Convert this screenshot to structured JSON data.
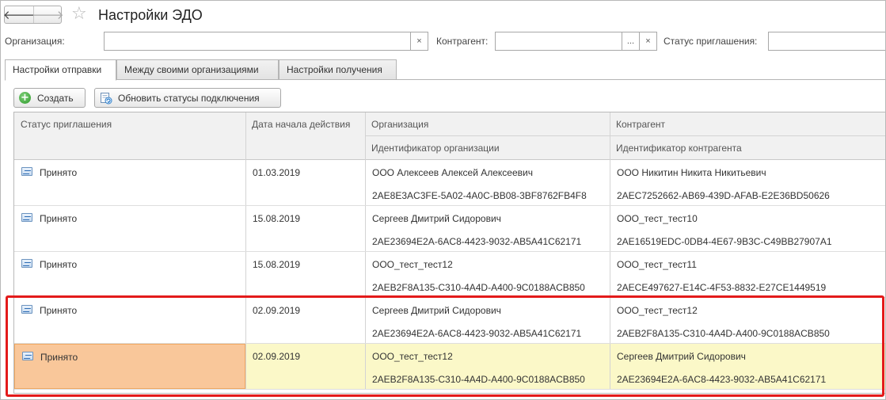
{
  "window": {
    "title": "Настройки ЭДО"
  },
  "filters": {
    "organization_label": "Организация:",
    "organization_value": "",
    "counterparty_label": "Контрагент:",
    "counterparty_value": "",
    "status_label": "Статус приглашения:",
    "status_value": "",
    "clear_glyph": "×",
    "choose_glyph": "..."
  },
  "tabs": [
    {
      "label": "Настройки отправки",
      "active": true
    },
    {
      "label": "Между своими организациями",
      "active": false
    },
    {
      "label": "Настройки получения",
      "active": false
    }
  ],
  "toolbar": {
    "create_label": "Создать",
    "refresh_label": "Обновить статусы подключения"
  },
  "table": {
    "headers": {
      "status": "Статус приглашения",
      "date": "Дата начала действия",
      "organization": "Организация",
      "organization_id": "Идентификатор организации",
      "counterparty": "Контрагент",
      "counterparty_id": "Идентификатор контрагента"
    },
    "rows": [
      {
        "status": "Принято",
        "date": "01.03.2019",
        "organization": "ООО Алексеев Алексей Алексеевич",
        "organization_id": "2AE8E3AC3FE-5A02-4A0C-BB08-3BF8762FB4F8",
        "counterparty": "ООО Никитин Никита Никитьевич",
        "counterparty_id": "2AEC7252662-AB69-439D-AFAB-E2E36BD50626"
      },
      {
        "status": "Принято",
        "date": "15.08.2019",
        "organization": "Сергеев Дмитрий Сидорович",
        "organization_id": "2AE23694E2A-6AC8-4423-9032-AB5A41C62171",
        "counterparty": "ООО_тест_тест10",
        "counterparty_id": "2AE16519EDC-0DB4-4E67-9B3C-C49BB27907A1"
      },
      {
        "status": "Принято",
        "date": "15.08.2019",
        "organization": "ООО_тест_тест12",
        "organization_id": "2AEB2F8A135-C310-4A4D-A400-9C0188ACB850",
        "counterparty": "ООО_тест_тест11",
        "counterparty_id": "2AECE497627-E14C-4F53-8832-E27CE1449519"
      },
      {
        "status": "Принято",
        "date": "02.09.2019",
        "organization": "Сергеев Дмитрий Сидорович",
        "organization_id": "2AE23694E2A-6AC8-4423-9032-AB5A41C62171",
        "counterparty": "ООО_тест_тест12",
        "counterparty_id": "2AEB2F8A135-C310-4A4D-A400-9C0188ACB850"
      },
      {
        "status": "Принято",
        "date": "02.09.2019",
        "organization": "ООО_тест_тест12",
        "organization_id": "2AEB2F8A135-C310-4A4D-A400-9C0188ACB850",
        "counterparty": "Сергеев Дмитрий Сидорович",
        "counterparty_id": "2AE23694E2A-6AC8-4423-9032-AB5A41C62171",
        "selected": true
      }
    ]
  },
  "colors": {
    "highlight_border": "#e31b1b",
    "selected_row": "#fbf8c8",
    "selected_cell": "#f9c79a"
  }
}
